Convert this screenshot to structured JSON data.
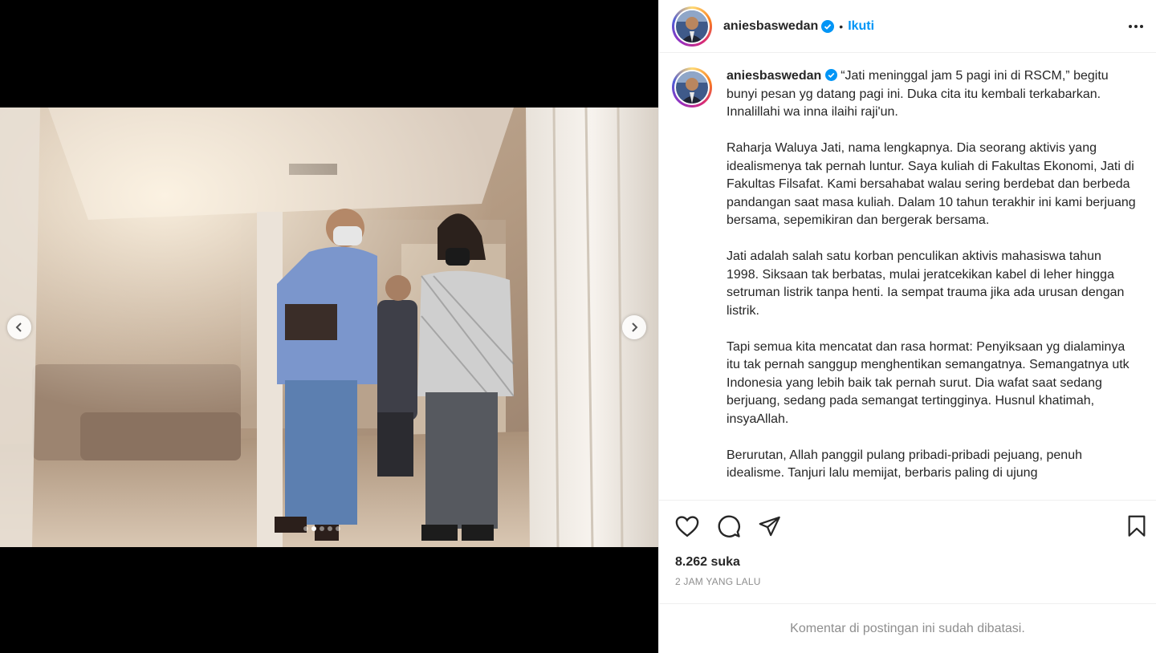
{
  "header": {
    "username": "aniesbaswedan",
    "separator": "•",
    "follow_label": "Ikuti"
  },
  "caption": {
    "username": "aniesbaswedan",
    "paragraphs": [
      "“Jati meninggal jam 5 pagi ini di RSCM,” begitu bunyi pesan yg datang pagi ini. Duka cita itu kembali terkabarkan. Innalillahi wa inna ilaihi raji'un.",
      "Raharja Waluya Jati, nama lengkapnya. Dia seorang aktivis yang idealismenya tak pernah luntur. Saya kuliah di Fakultas Ekonomi, Jati di Fakultas Filsafat. Kami bersahabat walau sering berdebat dan berbeda pandangan saat masa kuliah. Dalam 10 tahun terakhir ini kami berjuang bersama, sepemikiran dan bergerak bersama.",
      "Jati adalah salah satu korban penculikan aktivis mahasiswa tahun 1998. Siksaan tak berbatas, mulai jeratcekikan kabel di leher hingga setruman listrik tanpa henti. Ia sempat trauma jika ada urusan dengan listrik.",
      "Tapi semua kita mencatat dan rasa hormat: Penyiksaan yg dialaminya itu tak pernah sanggup menghentikan semangatnya. Semangatnya utk Indonesia yang lebih baik tak pernah surut. Dia wafat saat sedang berjuang, sedang pada semangat tertingginya. Husnul khatimah, insyaAllah.",
      "Berurutan, Allah panggil pulang pribadi-pribadi pejuang, penuh idealisme. Tanjuri lalu memijat, berbaris paling di ujung"
    ]
  },
  "actions": {
    "icons": [
      "heart-icon",
      "comment-icon",
      "share-icon",
      "bookmark-icon"
    ]
  },
  "stats": {
    "likes": "8.262 suka",
    "time": "2 JAM YANG LALU"
  },
  "footer": {
    "comments_limited": "Komentar di postingan ini sudah dibatasi."
  },
  "carousel": {
    "slide_count": 5,
    "active_index": 1
  },
  "colors": {
    "accent": "#0095f6",
    "verified": "#0095f6",
    "muted": "#8e8e8e",
    "text": "#262626"
  }
}
